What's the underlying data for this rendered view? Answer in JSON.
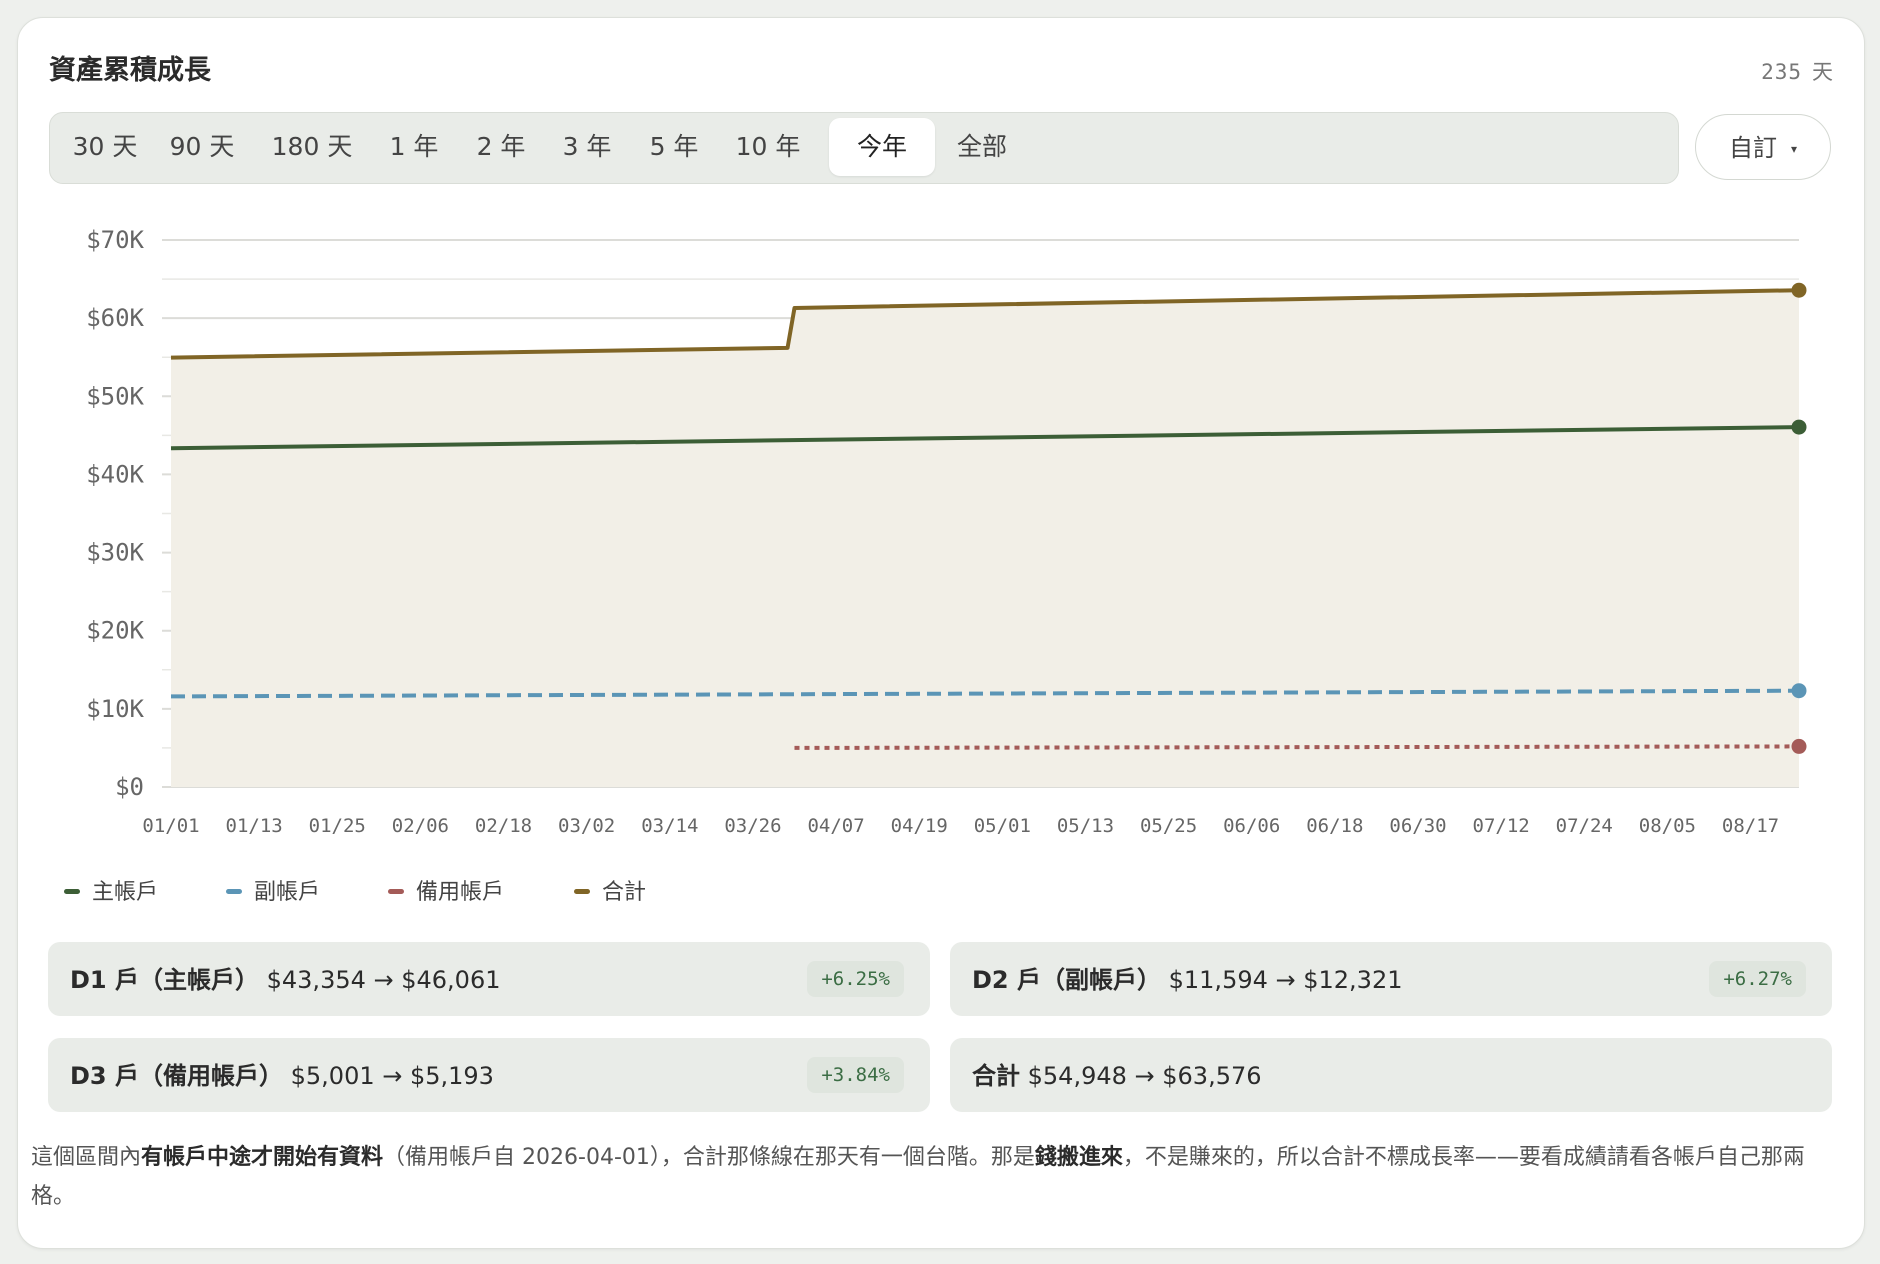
{
  "title": "資產累積成長",
  "days": {
    "count": "235",
    "unit": "天"
  },
  "ranges": [
    "30 天",
    "90 天",
    "180 天",
    "1 年",
    "2 年",
    "3 年",
    "5 年",
    "10 年",
    "今年",
    "全部"
  ],
  "active_range": "今年",
  "custom": {
    "label": "自訂",
    "caret": "▾"
  },
  "colors": {
    "main": "#3c5e36",
    "sub": "#5b95b6",
    "backup": "#a45b58",
    "total": "#806526",
    "fill": "#f2efe7"
  },
  "chart_data": {
    "type": "line",
    "ylim": [
      0,
      70000
    ],
    "y_ticks": [
      0,
      10000,
      20000,
      30000,
      40000,
      50000,
      60000,
      70000
    ],
    "y_tick_labels": [
      "$0",
      "$10K",
      "$20K",
      "$30K",
      "$40K",
      "$50K",
      "$60K",
      "$70K"
    ],
    "x_range": [
      "2026-01-01",
      "2026-08-24"
    ],
    "x_tick_labels": [
      "01/01",
      "01/13",
      "01/25",
      "02/06",
      "02/18",
      "03/02",
      "03/14",
      "03/26",
      "04/07",
      "04/19",
      "05/01",
      "05/13",
      "05/25",
      "06/06",
      "06/18",
      "06/30",
      "07/12",
      "07/24",
      "08/05",
      "08/17"
    ],
    "grid": true,
    "legend_position": "bottom-left",
    "series": [
      {
        "name": "主帳戶",
        "key": "main",
        "style": "solid",
        "points": [
          [
            "2026-01-01",
            43354
          ],
          [
            "2026-08-24",
            46061
          ]
        ]
      },
      {
        "name": "副帳戶",
        "key": "sub",
        "style": "dashed",
        "points": [
          [
            "2026-01-01",
            11594
          ],
          [
            "2026-08-24",
            12321
          ]
        ]
      },
      {
        "name": "備用帳戶",
        "key": "backup",
        "style": "dotted",
        "points": [
          [
            "2026-04-01",
            5001
          ],
          [
            "2026-08-24",
            5193
          ]
        ]
      },
      {
        "name": "合計",
        "key": "total",
        "style": "solid",
        "fill": true,
        "points": [
          [
            "2026-01-01",
            54948
          ],
          [
            "2026-03-31",
            56200
          ],
          [
            "2026-04-01",
            61300
          ],
          [
            "2026-08-24",
            63576
          ]
        ]
      }
    ]
  },
  "stats": [
    {
      "name_bold": "D1 戶（主帳戶）",
      "range": "$43,354 → $46,061",
      "change": "+6.25%"
    },
    {
      "name_bold": "D2 戶（副帳戶）",
      "range": "$11,594 → $12,321",
      "change": "+6.27%"
    },
    {
      "name_bold": "D3 戶（備用帳戶）",
      "range": "$5,001 → $5,193",
      "change": "+3.84%"
    },
    {
      "name_bold": "合計",
      "range": "$54,948 → $63,576",
      "change": ""
    }
  ],
  "note": {
    "p1": "這個區間內",
    "b1": "有帳戶中途才開始有資料",
    "p2": "（備用帳戶自 2026-04-01），合計那條線在那天有一個台階。那是",
    "b2": "錢搬進來",
    "p3": "，不是賺來的，所以合計不標成長率——要看成績請看各帳戶自己那兩格。"
  }
}
